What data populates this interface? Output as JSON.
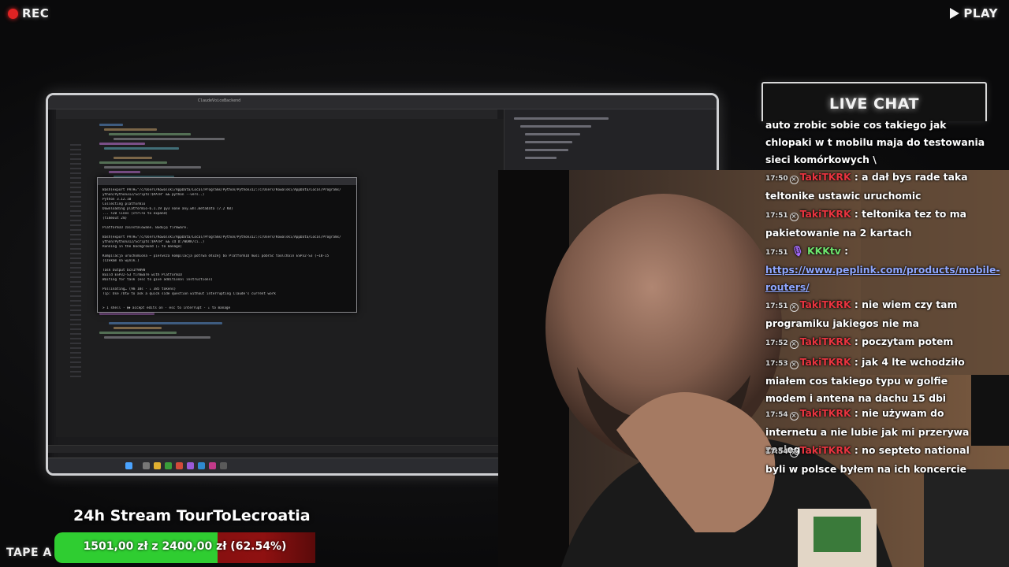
{
  "overlay": {
    "rec_label": "REC",
    "play_label": "PLAY",
    "tape_label": "TAPE A"
  },
  "screen": {
    "ide_title": "ClaudeVoiceBackend",
    "terminal_lines": [
      "Bash(export PATH=\"/c/Users/Kowalski/AppData/Local/Programs/Python/Python312:/c/Users/Kowalski/AppData/Local/Programs/",
      "  ython/Python312/Scripts:$PATH\" && python --vers..)",
      "  Python 3.12.10",
      "  Collecting platformio",
      "    Downloading platformio-6.1.19 py3 none any.whl.metadata (7.2 KB)",
      "    ... +20 lines (ctrl+o to expand)",
      "  (timeout 2m)",
      "",
      "PlatformIO zainstalowane. Buduję firmware.",
      "",
      "Bash(export PATH=\"/c/Users/Kowalski/AppData/Local/Programs/Python/Python312:/c/Users/Kowalski/AppData/Local/Programs/",
      "  ython/Python312/Scripts:$PATH\" && cd D:/WORK/ci..)",
      "  Running in the background (↓ to manage)",
      "",
      "Kompilacja uruchomiona — pierwsza kompilacja potrwa dłużej bo PlatformIO musi pobrać toolchain ESP32-S3 (~10-15",
      "  (Czekam na wynik.)",
      "",
      "Task Output bcn1f9890",
      "Build ESP32-S3 firmware with PlatformIO",
      "  Waiting for task (esc to give additional instructions)",
      "",
      "Pollinating… (9m 10s · ↓ 385 tokens)",
      "  Tip: Use /btw to ask a quick side question without interrupting Claude's current work",
      "",
      "",
      "> 1 shell · ⏵⏵ accept edits on · esc to interrupt · ↓ to manage"
    ]
  },
  "chat": {
    "title": "LIVE CHAT",
    "messages": [
      {
        "time": "",
        "user": "",
        "text": "auto zrobic sobie cos takiego jak chlopaki w t mobilu maja do testowania sieci komórkowych \\"
      },
      {
        "time": "17:50",
        "user": "TakiTKRK",
        "text": ": a dał bys rade taka teltonike ustawic uruchomic"
      },
      {
        "time": "17:51",
        "user": "TakiTKRK",
        "text": ": teltonika tez to ma pakietowanie na 2 kartach"
      },
      {
        "time": "17:51",
        "user": "KKKtv",
        "text": ":",
        "link": "https://www.peplink.com/products/mobile-routers/"
      },
      {
        "time": "17:51",
        "user": "TakiTKRK",
        "text": ": nie wiem czy tam programiku jakiegos nie ma"
      },
      {
        "time": "17:52",
        "user": "TakiTKRK",
        "text": ": poczytam potem"
      },
      {
        "time": "17:53",
        "user": "TakiTKRK",
        "text": ": jak 4 lte wchodziło miałem cos takiego typu w golfie modem i antena na dachu 15 dbi"
      },
      {
        "time": "17:54",
        "user": "TakiTKRK",
        "text": ": nie używam do internetu a nie lubie jak mi przerywa zasieg"
      },
      {
        "time": "17:54",
        "user": "TakiTKRK",
        "text": ": no septeto national byli w polsce byłem na ich koncercie"
      }
    ]
  },
  "goal": {
    "title": "24h Stream TourToLecroatia",
    "text": "1501,00 zł z 2400,00 zł (62.54%)",
    "progress": 0.6254,
    "color_fill": "#2fcd31",
    "color_bg": "#8f1111"
  }
}
